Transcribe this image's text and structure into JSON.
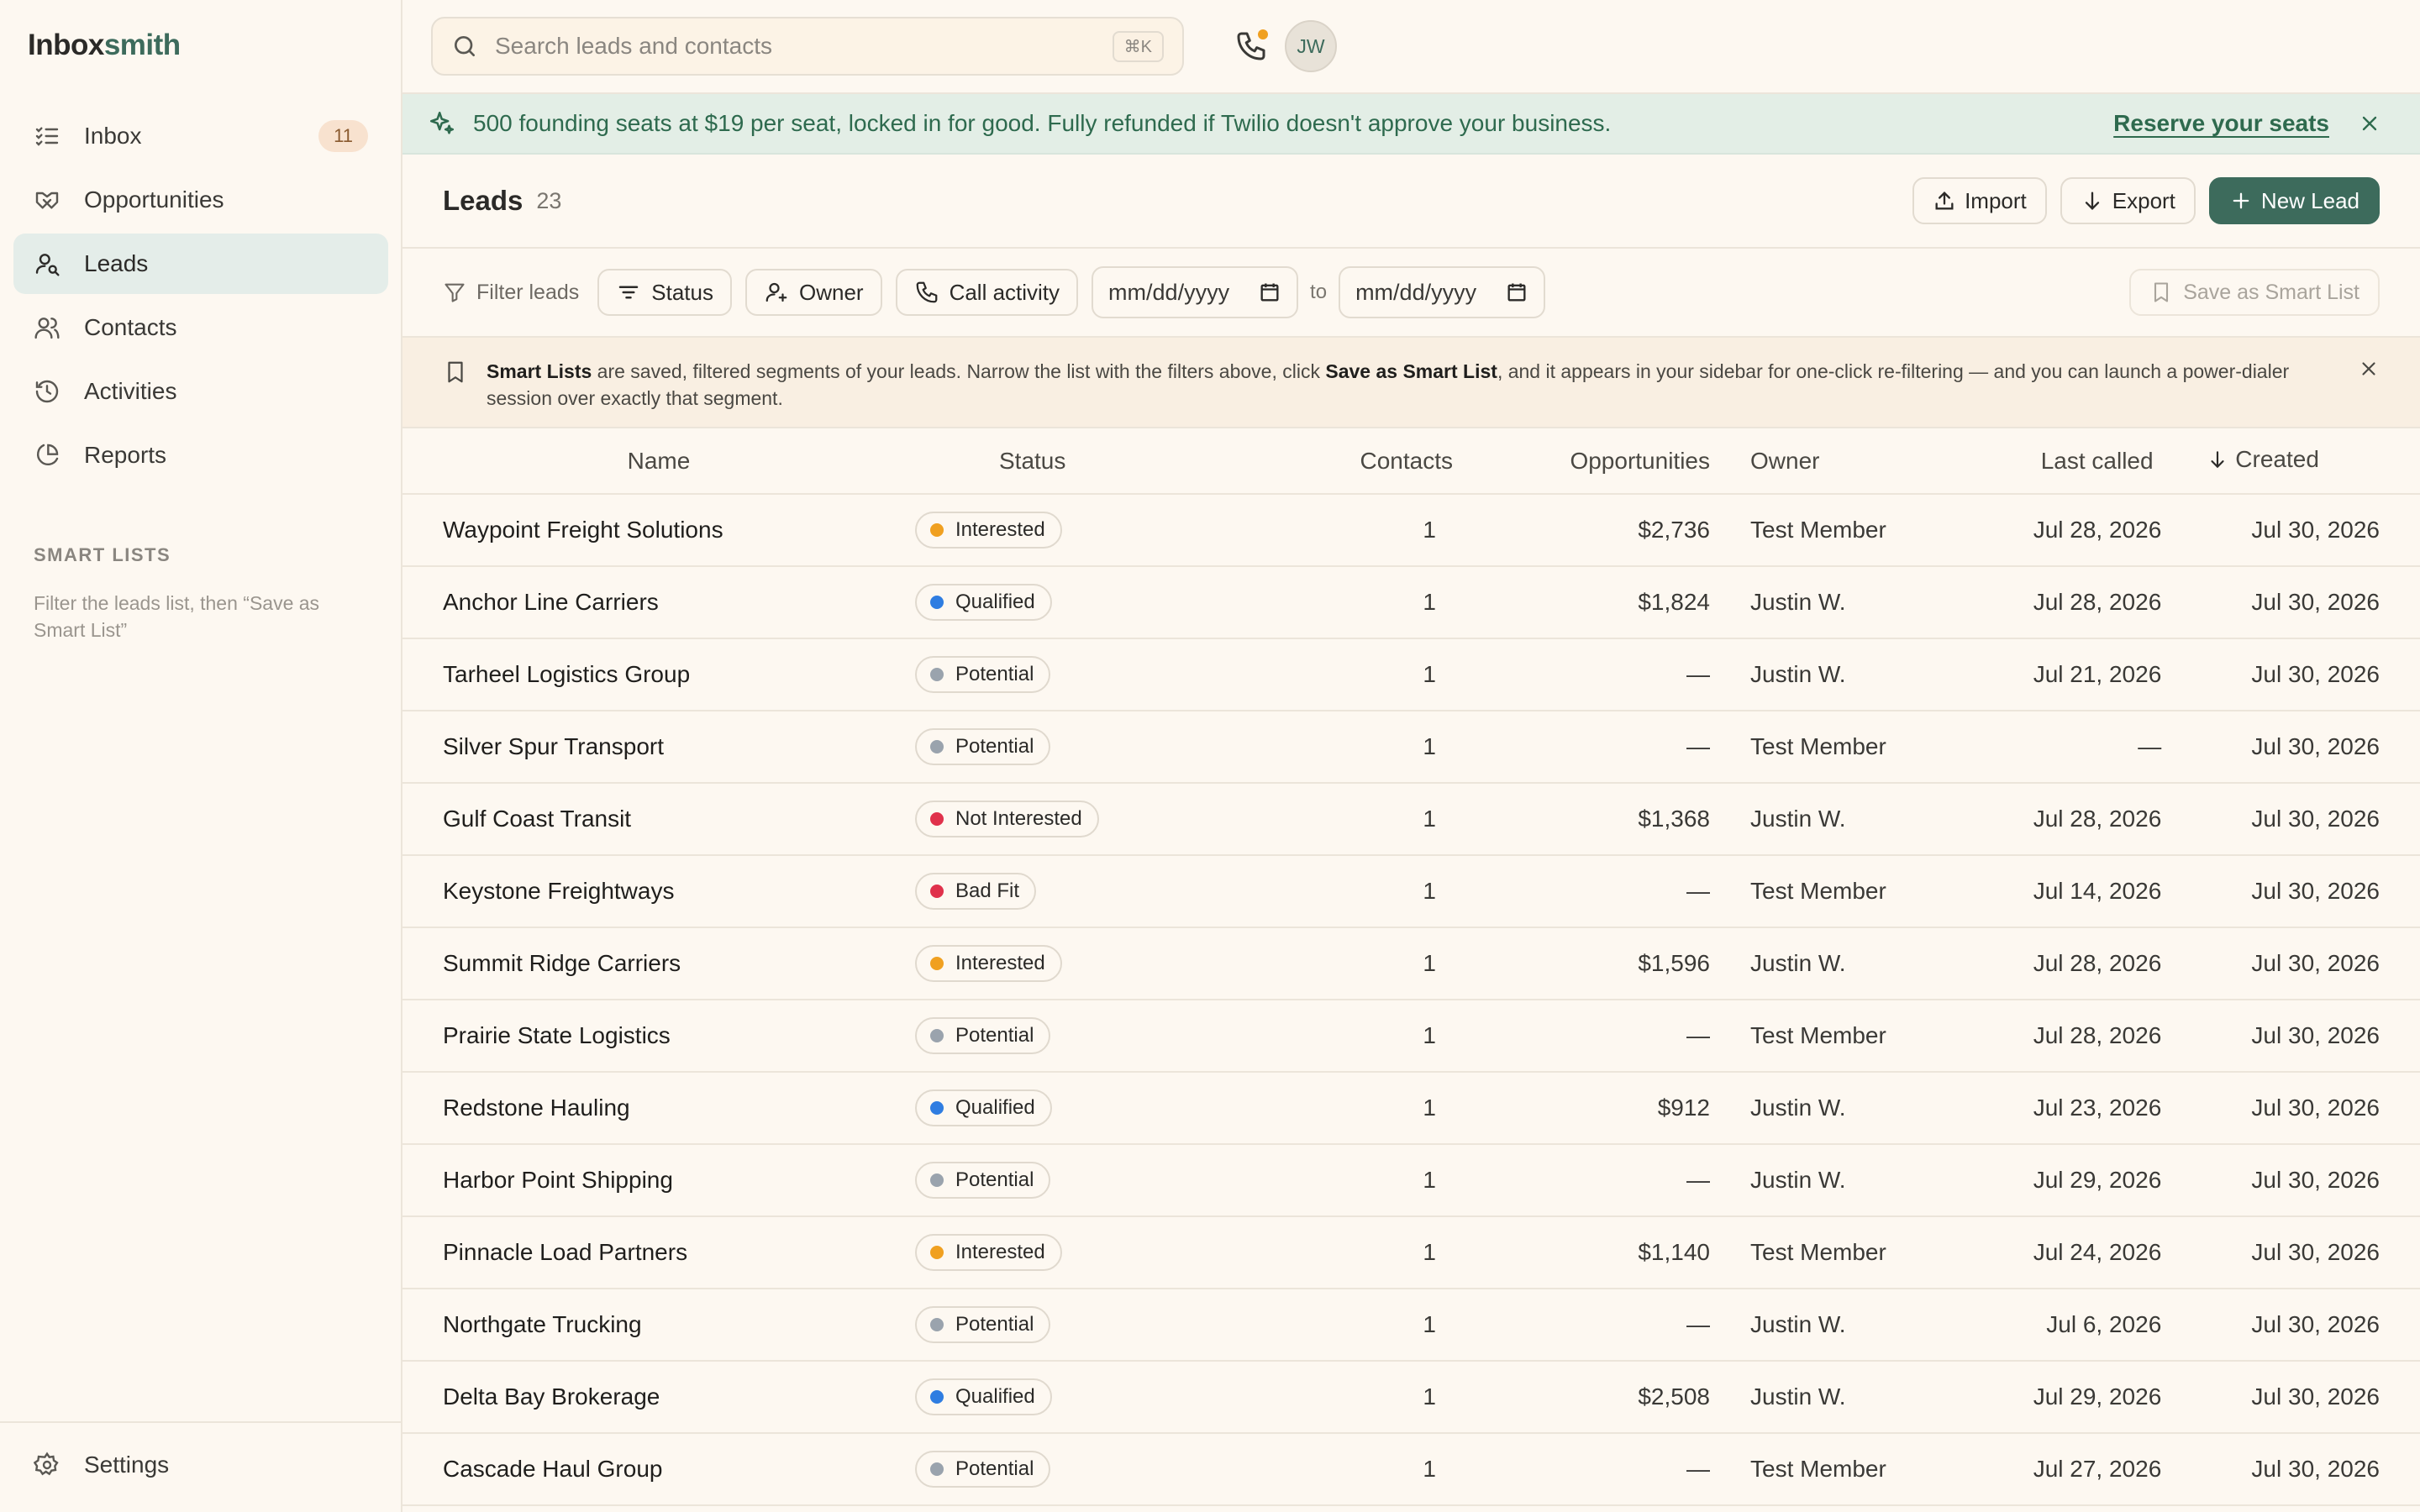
{
  "app": {
    "brand_part1": "Inbox",
    "brand_part2": "smith"
  },
  "sidebar": {
    "items": [
      {
        "label": "Inbox",
        "badge": "11"
      },
      {
        "label": "Opportunities"
      },
      {
        "label": "Leads"
      },
      {
        "label": "Contacts"
      },
      {
        "label": "Activities"
      },
      {
        "label": "Reports"
      }
    ],
    "smart_lists_heading": "SMART LISTS",
    "smart_lists_hint": "Filter the leads list, then “Save as Smart List”",
    "settings_label": "Settings"
  },
  "topbar": {
    "search_placeholder": "Search leads and contacts",
    "shortcut": "⌘K",
    "avatar_initials": "JW"
  },
  "banner": {
    "text": "500 founding seats at $19 per seat, locked in for good. Fully refunded if Twilio doesn't approve your business.",
    "link": "Reserve your seats"
  },
  "header": {
    "title": "Leads",
    "count": "23",
    "import_label": "Import",
    "export_label": "Export",
    "new_label": "New Lead"
  },
  "filters": {
    "filter_label": "Filter leads",
    "status": "Status",
    "owner": "Owner",
    "call_activity": "Call activity",
    "date_from": "mm/dd/yyyy",
    "to": "to",
    "date_to": "mm/dd/yyyy",
    "save_smart": "Save as Smart List"
  },
  "info": {
    "part1": "Smart Lists",
    "part2": " are saved, filtered segments of your leads. Narrow the list with the filters above, click ",
    "part3": "Save as Smart List",
    "part4": ", and it appears in your sidebar for one-click re-filtering — and you can launch a power-dialer session over exactly that segment."
  },
  "table": {
    "columns": [
      "Name",
      "Status",
      "Contacts",
      "Opportunities",
      "Owner",
      "Last called",
      "Created"
    ],
    "status_colors": {
      "Interested": "#f0a020",
      "Qualified": "#2f7de1",
      "Potential": "#9aa3ad",
      "Not Interested": "#e0314b",
      "Bad Fit": "#e0314b"
    },
    "rows": [
      {
        "name": "Waypoint Freight Solutions",
        "status": "Interested",
        "contacts": "1",
        "opps": "$2,736",
        "owner": "Test Member",
        "last": "Jul 28, 2026",
        "created": "Jul 30, 2026"
      },
      {
        "name": "Anchor Line Carriers",
        "status": "Qualified",
        "contacts": "1",
        "opps": "$1,824",
        "owner": "Justin W.",
        "last": "Jul 28, 2026",
        "created": "Jul 30, 2026"
      },
      {
        "name": "Tarheel Logistics Group",
        "status": "Potential",
        "contacts": "1",
        "opps": "—",
        "owner": "Justin W.",
        "last": "Jul 21, 2026",
        "created": "Jul 30, 2026"
      },
      {
        "name": "Silver Spur Transport",
        "status": "Potential",
        "contacts": "1",
        "opps": "—",
        "owner": "Test Member",
        "last": "—",
        "created": "Jul 30, 2026"
      },
      {
        "name": "Gulf Coast Transit",
        "status": "Not Interested",
        "contacts": "1",
        "opps": "$1,368",
        "owner": "Justin W.",
        "last": "Jul 28, 2026",
        "created": "Jul 30, 2026"
      },
      {
        "name": "Keystone Freightways",
        "status": "Bad Fit",
        "contacts": "1",
        "opps": "—",
        "owner": "Test Member",
        "last": "Jul 14, 2026",
        "created": "Jul 30, 2026"
      },
      {
        "name": "Summit Ridge Carriers",
        "status": "Interested",
        "contacts": "1",
        "opps": "$1,596",
        "owner": "Justin W.",
        "last": "Jul 28, 2026",
        "created": "Jul 30, 2026"
      },
      {
        "name": "Prairie State Logistics",
        "status": "Potential",
        "contacts": "1",
        "opps": "—",
        "owner": "Test Member",
        "last": "Jul 28, 2026",
        "created": "Jul 30, 2026"
      },
      {
        "name": "Redstone Hauling",
        "status": "Qualified",
        "contacts": "1",
        "opps": "$912",
        "owner": "Justin W.",
        "last": "Jul 23, 2026",
        "created": "Jul 30, 2026"
      },
      {
        "name": "Harbor Point Shipping",
        "status": "Potential",
        "contacts": "1",
        "opps": "—",
        "owner": "Justin W.",
        "last": "Jul 29, 2026",
        "created": "Jul 30, 2026"
      },
      {
        "name": "Pinnacle Load Partners",
        "status": "Interested",
        "contacts": "1",
        "opps": "$1,140",
        "owner": "Test Member",
        "last": "Jul 24, 2026",
        "created": "Jul 30, 2026"
      },
      {
        "name": "Northgate Trucking",
        "status": "Potential",
        "contacts": "1",
        "opps": "—",
        "owner": "Justin W.",
        "last": "Jul 6, 2026",
        "created": "Jul 30, 2026"
      },
      {
        "name": "Delta Bay Brokerage",
        "status": "Qualified",
        "contacts": "1",
        "opps": "$2,508",
        "owner": "Justin W.",
        "last": "Jul 29, 2026",
        "created": "Jul 30, 2026"
      },
      {
        "name": "Cascade Haul Group",
        "status": "Potential",
        "contacts": "1",
        "opps": "—",
        "owner": "Test Member",
        "last": "Jul 27, 2026",
        "created": "Jul 30, 2026"
      }
    ]
  },
  "colors": {
    "accent": "#3d6b5c",
    "banner_bg": "#e3eee6",
    "page_bg": "#fdf8f1"
  }
}
